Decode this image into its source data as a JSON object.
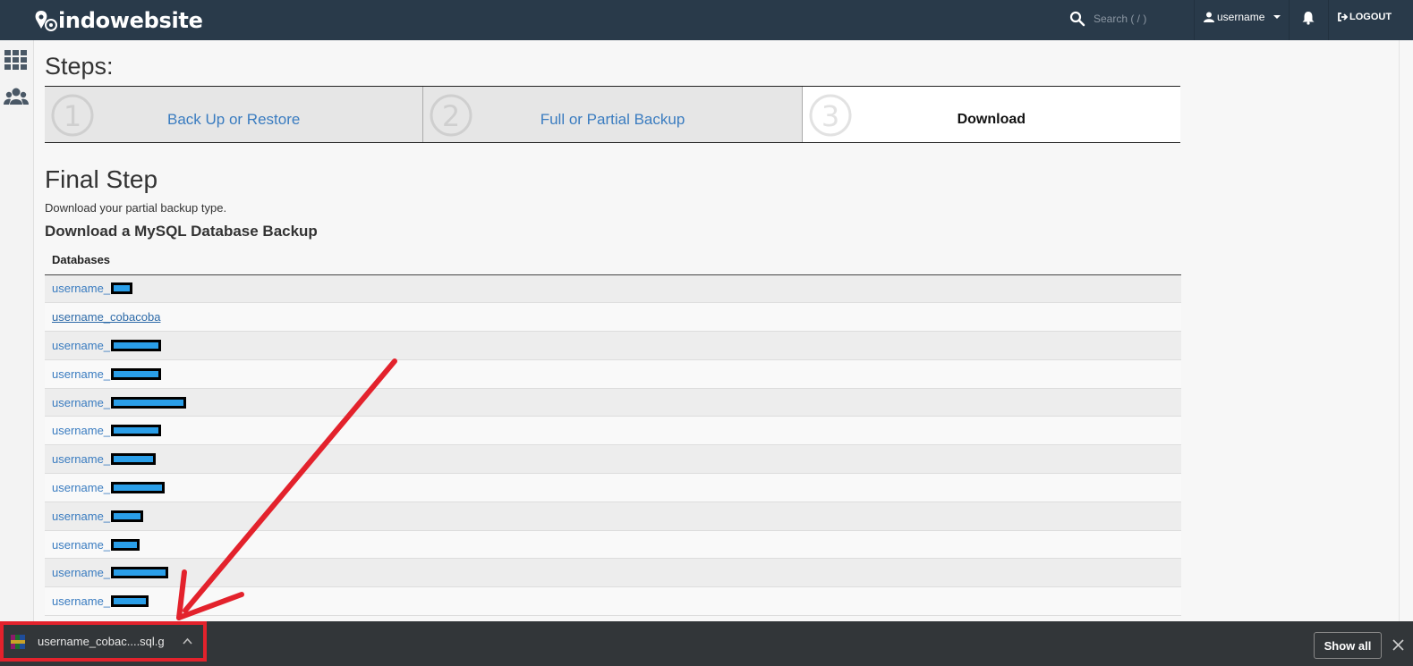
{
  "header": {
    "brand": "indowebsite",
    "search_placeholder": "Search ( / )",
    "username": "username",
    "logout_label": "LOGOUT"
  },
  "steps": {
    "title": "Steps:",
    "items": [
      {
        "number": "1",
        "label": "Back Up or Restore"
      },
      {
        "number": "2",
        "label": "Full or Partial Backup"
      },
      {
        "number": "3",
        "label": "Download"
      }
    ]
  },
  "main": {
    "final_title": "Final Step",
    "final_subtitle": "Download your partial backup type.",
    "section_title": "Download a MySQL Database Backup",
    "table_header": "Databases",
    "databases": [
      "username_",
      "username_cobacoba",
      "username_",
      "username_",
      "username_",
      "username_",
      "username_",
      "username_",
      "username_",
      "username_",
      "username_",
      "username_"
    ]
  },
  "download_bar": {
    "file_name": "username_cobac....sql.g",
    "show_all": "Show all"
  },
  "colors": {
    "topbar": "#293a4a",
    "link": "#3a7cc0",
    "annotation": "#e3222c"
  }
}
